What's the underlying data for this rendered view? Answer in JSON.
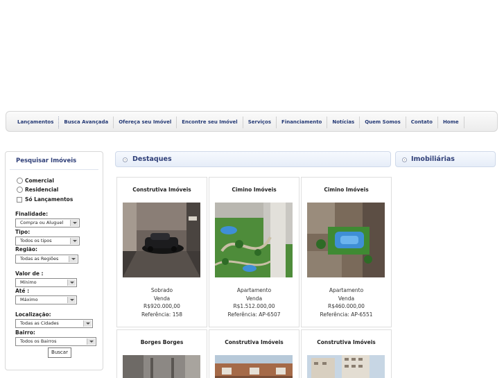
{
  "nav": {
    "items": [
      "Lançamentos",
      "Busca Avançada",
      "Ofereça seu Imóvel",
      "Encontre seu Imóvel",
      "Serviços",
      "Financiamento",
      "Notícias",
      "Quem Somos",
      "Contato",
      "Home"
    ]
  },
  "search": {
    "title": "Pesquisar Imóveis",
    "options": {
      "comercial": "Comercial",
      "residencial": "Residencial",
      "lancamentos": "Só Lançamentos"
    },
    "labels": {
      "finalidade": "Finalidade:",
      "tipo": "Tipo:",
      "regiao": "Região:",
      "valor_de": "Valor de :",
      "ate": "Até :",
      "localizacao": "Localização:",
      "bairro": "Bairro:"
    },
    "selects": {
      "finalidade": "Compra ou Aluguel",
      "tipo": "Todos os tipos",
      "regiao": "Todas as Regiões",
      "valor_de": "Mínimo",
      "ate": "Máximo",
      "localizacao": "Todas as Cidades",
      "bairro": "Todos os Bairros"
    },
    "button": "Buscar"
  },
  "destaques": {
    "title": "Destaques"
  },
  "imobiliarias": {
    "title": "Imobiliárias"
  },
  "listings": [
    {
      "agency": "Construtiva Imóveis",
      "type": "Sobrado",
      "deal": "Venda",
      "price": "R$920.000,00",
      "ref": "Referência: 158"
    },
    {
      "agency": "Cimino Imóveis",
      "type": "Apartamento",
      "deal": "Venda",
      "price": "R$1.512.000,00",
      "ref": "Referência: AP-6507"
    },
    {
      "agency": "Cimino Imóveis",
      "type": "Apartamento",
      "deal": "Venda",
      "price": "R$460.000,00",
      "ref": "Referência: AP-6551"
    },
    {
      "agency": "Borges Borges"
    },
    {
      "agency": "Construtiva Imóveis"
    },
    {
      "agency": "Construtiva Imóveis"
    }
  ],
  "colors": {
    "nav_text": "#253a75",
    "heading": "#2f3f78",
    "pool": "#3f8fd6",
    "grass": "#3f8a33"
  }
}
